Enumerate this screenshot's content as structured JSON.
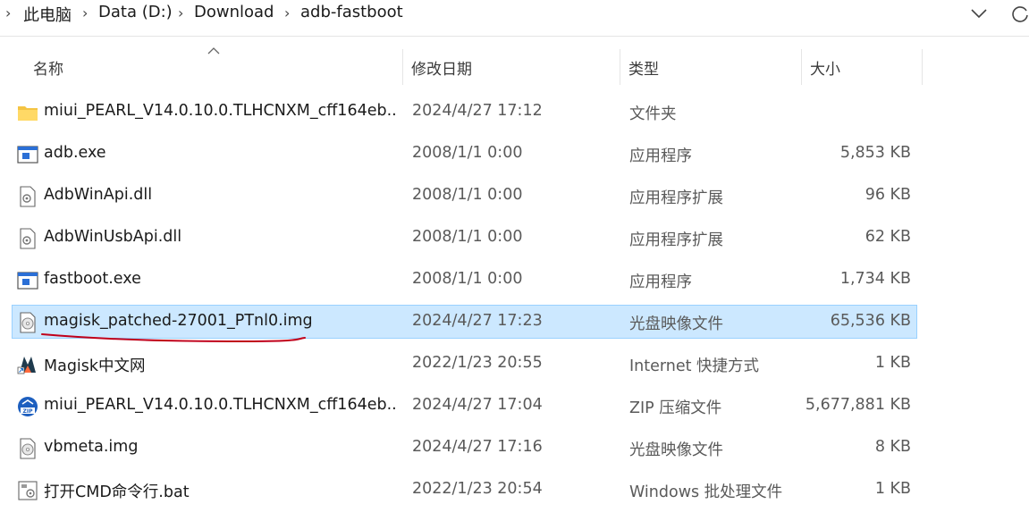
{
  "breadcrumb": {
    "items": [
      "此电脑",
      "Data (D:)",
      "Download",
      "adb-fastboot"
    ]
  },
  "header": {
    "name": "名称",
    "date": "修改日期",
    "type": "类型",
    "size": "大小"
  },
  "files": [
    {
      "name": "miui_PEARL_V14.0.10.0.TLHCNXM_cff164eb...",
      "date": "2024/4/27 17:12",
      "type": "文件夹",
      "size": "",
      "icon": "folder-icon"
    },
    {
      "name": "adb.exe",
      "date": "2008/1/1 0:00",
      "type": "应用程序",
      "size": "5,853 KB",
      "icon": "exe-icon"
    },
    {
      "name": "AdbWinApi.dll",
      "date": "2008/1/1 0:00",
      "type": "应用程序扩展",
      "size": "96 KB",
      "icon": "dll-icon"
    },
    {
      "name": "AdbWinUsbApi.dll",
      "date": "2008/1/1 0:00",
      "type": "应用程序扩展",
      "size": "62 KB",
      "icon": "dll-icon"
    },
    {
      "name": "fastboot.exe",
      "date": "2008/1/1 0:00",
      "type": "应用程序",
      "size": "1,734 KB",
      "icon": "exe-icon"
    },
    {
      "name": "magisk_patched-27001_PTnl0.img",
      "date": "2024/4/27 17:23",
      "type": "光盘映像文件",
      "size": "65,536 KB",
      "icon": "disc-image-icon",
      "selected": true
    },
    {
      "name": "Magisk中文网",
      "date": "2022/1/23 20:55",
      "type": "Internet 快捷方式",
      "size": "1 KB",
      "icon": "magisk-shortcut-icon"
    },
    {
      "name": "miui_PEARL_V14.0.10.0.TLHCNXM_cff164eb...",
      "date": "2024/4/27 17:04",
      "type": "ZIP 压缩文件",
      "size": "5,677,881 KB",
      "icon": "zip-icon"
    },
    {
      "name": "vbmeta.img",
      "date": "2024/4/27 17:16",
      "type": "光盘映像文件",
      "size": "8 KB",
      "icon": "disc-image-icon"
    },
    {
      "name": "打开CMD命令行.bat",
      "date": "2022/1/23 20:54",
      "type": "Windows 批处理文件",
      "size": "1 KB",
      "icon": "bat-icon"
    }
  ],
  "colors": {
    "selection_bg": "#cce8ff",
    "selection_border": "#99d1ff",
    "annotation_underline": "#c0001a"
  }
}
